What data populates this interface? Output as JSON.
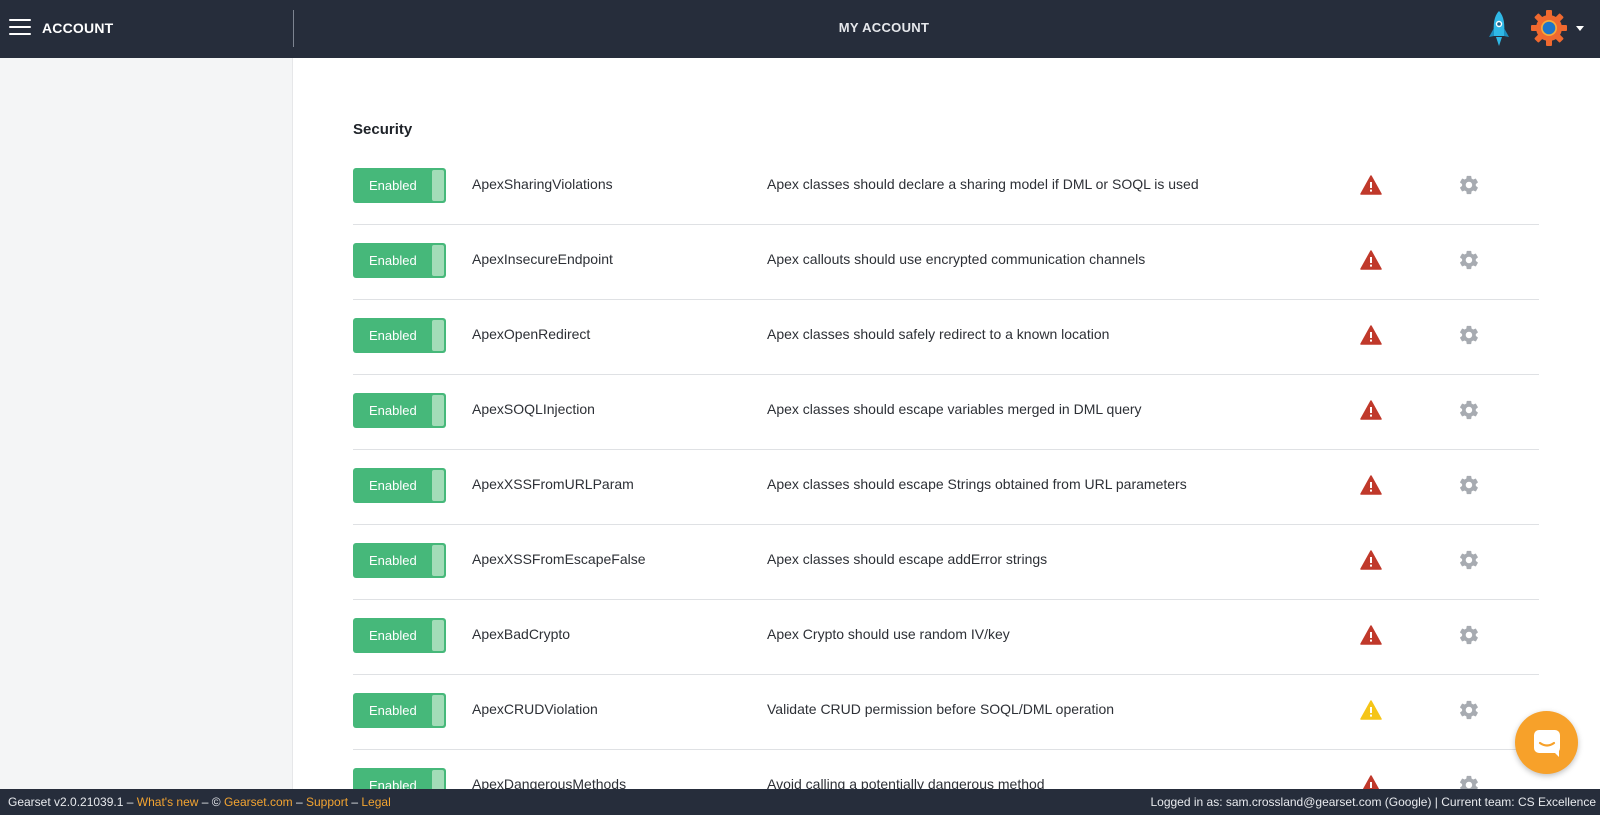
{
  "header": {
    "section_label": "ACCOUNT",
    "page_title": "MY ACCOUNT"
  },
  "content": {
    "section_title": "Security",
    "rules": [
      {
        "status": "Enabled",
        "name": "ApexSharingViolations",
        "description": "Apex classes should declare a sharing model if DML or SOQL is used",
        "severity": "high"
      },
      {
        "status": "Enabled",
        "name": "ApexInsecureEndpoint",
        "description": "Apex callouts should use encrypted communication channels",
        "severity": "high"
      },
      {
        "status": "Enabled",
        "name": "ApexOpenRedirect",
        "description": "Apex classes should safely redirect to a known location",
        "severity": "high"
      },
      {
        "status": "Enabled",
        "name": "ApexSOQLInjection",
        "description": "Apex classes should escape variables merged in DML query",
        "severity": "high"
      },
      {
        "status": "Enabled",
        "name": "ApexXSSFromURLParam",
        "description": "Apex classes should escape Strings obtained from URL parameters",
        "severity": "high"
      },
      {
        "status": "Enabled",
        "name": "ApexXSSFromEscapeFalse",
        "description": "Apex classes should escape addError strings",
        "severity": "high"
      },
      {
        "status": "Enabled",
        "name": "ApexBadCrypto",
        "description": "Apex Crypto should use random IV/key",
        "severity": "high"
      },
      {
        "status": "Enabled",
        "name": "ApexCRUDViolation",
        "description": "Validate CRUD permission before SOQL/DML operation",
        "severity": "medium"
      },
      {
        "status": "Enabled",
        "name": "ApexDangerousMethods",
        "description": "Avoid calling a potentially dangerous method",
        "severity": "high"
      }
    ]
  },
  "footer": {
    "version": "Gearset v2.0.21039.1",
    "sep1": " – ",
    "whats_new": "What's new",
    "sep2": " – © ",
    "site": "Gearset.com",
    "sep3": " – ",
    "support": "Support",
    "sep4": " – ",
    "legal": "Legal",
    "logged_in": "Logged in as: sam.crossland@gearset.com (Google)",
    "team_sep": " | ",
    "current_team": "Current team: CS Excellence"
  },
  "colors": {
    "topbar": "#262d3b",
    "toggle_enabled": "#46b87a",
    "severity_high": "#c0392b",
    "severity_medium": "#f5c518",
    "link": "#f3a431",
    "chat": "#f7a12a"
  },
  "icons": {
    "menu": "hamburger-icon",
    "rocket": "rocket-icon",
    "settings": "gear-icon",
    "severity": "warning-triangle-icon",
    "chat": "chat-bubble-icon"
  }
}
